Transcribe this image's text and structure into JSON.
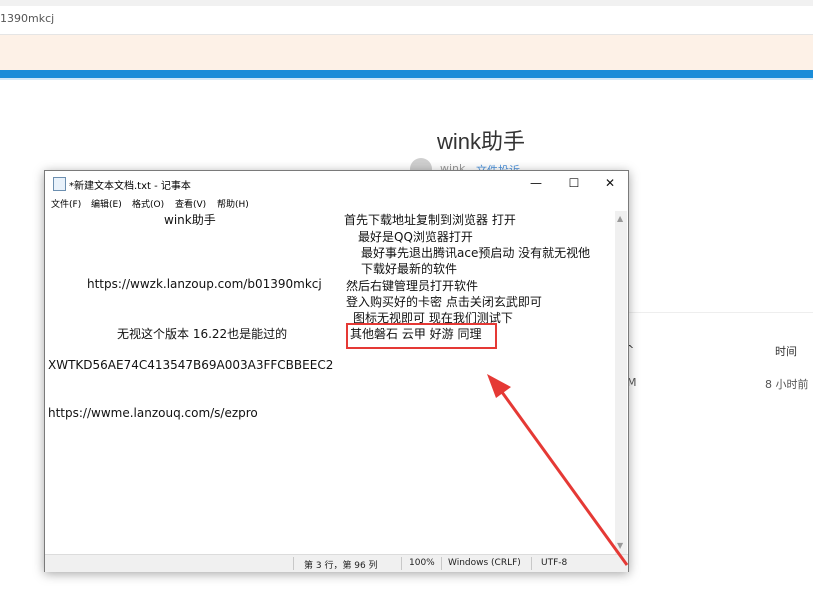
{
  "browser": {
    "url_fragment": "1390mkcj"
  },
  "page": {
    "title": "wink助手",
    "author": "wink",
    "report_link": "文件投诉",
    "table": {
      "col_frag": "^",
      "col_time": "时间",
      "row_frag": "M",
      "row_time": "8 小时前"
    }
  },
  "notepad": {
    "title": "*新建文本文档.txt - 记事本",
    "window_buttons": {
      "minimize": "—",
      "maximize": "☐",
      "close": "✕"
    },
    "menu": [
      "文件(F)",
      "编辑(E)",
      "格式(O)",
      "查看(V)",
      "帮助(H)"
    ],
    "lines_left": [
      "wink助手",
      "https://wwzk.lanzoup.com/b01390mkcj",
      "无视这个版本 16.22也是能过的",
      "XWTKD56AE74C413547B69A003A3FFCBBEEC2",
      "https://wwme.lanzouq.com/s/ezpro"
    ],
    "lines_right": [
      "首先下载地址复制到浏览器 打开",
      "最好是QQ浏览器打开",
      "最好事先退出腾讯ace预启动 没有就无视他",
      "下载好最新的软件",
      "然后右键管理员打开软件",
      "登入购买好的卡密 点击关闭玄武即可",
      "图标无视即可  现在我们测试下",
      "其他磐石 云甲 好游 同理"
    ],
    "status": {
      "position": "第 3 行，第 96 列",
      "zoom": "100%",
      "line_ending": "Windows (CRLF)",
      "encoding": "UTF-8"
    }
  },
  "colors": {
    "highlight": "#e53935",
    "accent_bar": "#1a8cd8"
  }
}
